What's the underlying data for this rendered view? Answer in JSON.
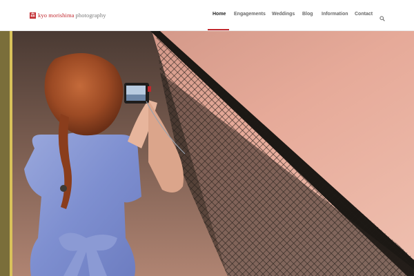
{
  "header": {
    "brand": {
      "mark": "森",
      "name": "kyo morishima",
      "suffix": "photography"
    },
    "nav": [
      {
        "label": "Home",
        "active": true
      },
      {
        "label": "Engagements",
        "active": false
      },
      {
        "label": "Weddings",
        "active": false
      },
      {
        "label": "Blog",
        "active": false
      },
      {
        "label": "Information",
        "active": false
      },
      {
        "label": "Contact",
        "active": false
      }
    ],
    "search_icon": "search-icon"
  },
  "hero": {
    "image": "girl-with-camera-by-railing"
  },
  "colors": {
    "brand_red": "#c1272d",
    "nav_text": "#666666",
    "nav_active": "#222222"
  }
}
